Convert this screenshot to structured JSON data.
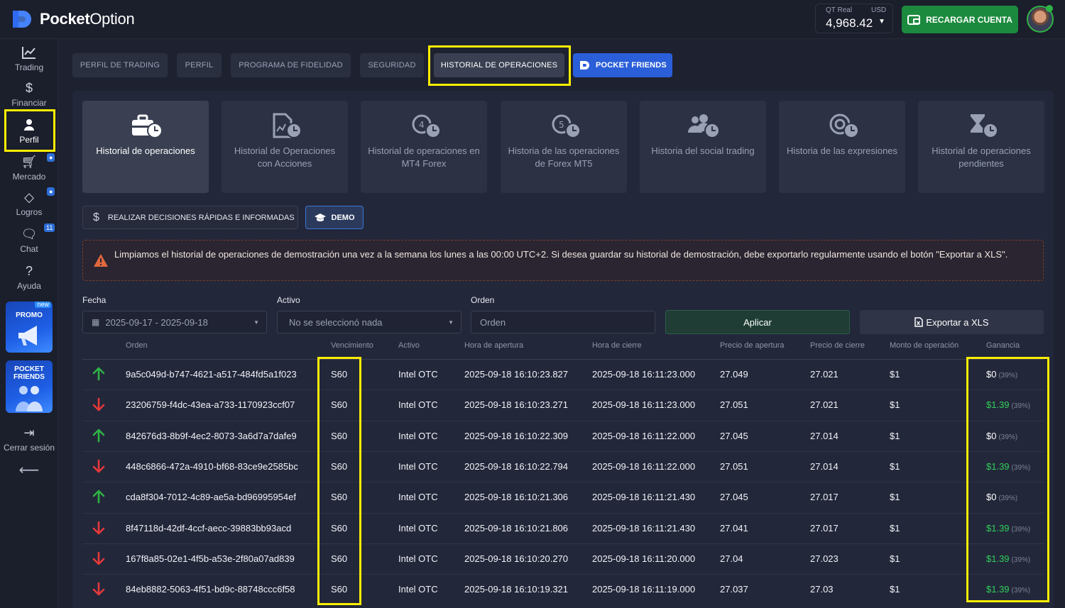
{
  "app": {
    "brand_bold": "Pocket",
    "brand_thin": "Option"
  },
  "account": {
    "type_label": "QT Real",
    "currency_label": "USD",
    "balance": "4,968.42",
    "recharge_label": "RECARGAR CUENTA"
  },
  "sidebar": {
    "items": [
      {
        "label": "Trading",
        "icon": "chart-line-icon"
      },
      {
        "label": "Financiar",
        "icon": "dollar-icon"
      },
      {
        "label": "Perfil",
        "icon": "user-icon"
      },
      {
        "label": "Mercado",
        "icon": "cart-icon"
      },
      {
        "label": "Logros",
        "icon": "diamond-icon"
      },
      {
        "label": "Chat",
        "icon": "chat-icon",
        "badge": "11"
      },
      {
        "label": "Ayuda",
        "icon": "help-icon"
      }
    ],
    "promo_label": "PROMO",
    "promo_new": "new",
    "friends_label_1": "POCKET",
    "friends_label_2": "FRIENDS",
    "logout_label": "Cerrar sesión"
  },
  "tabs": [
    {
      "label": "PERFIL DE TRADING"
    },
    {
      "label": "PERFIL"
    },
    {
      "label": "PROGRAMA DE FIDELIDAD"
    },
    {
      "label": "SEGURIDAD"
    },
    {
      "label": "HISTORIAL DE OPERACIONES",
      "active": true
    },
    {
      "label": "POCKET FRIENDS"
    }
  ],
  "categories": [
    {
      "label": "Historial de operaciones",
      "icon": "briefcase-clock-icon",
      "active": true
    },
    {
      "label": "Historial de Operaciones con Acciones",
      "icon": "document-chart-clock-icon"
    },
    {
      "label": "Historial de operaciones en MT4 Forex",
      "icon": "mt4-clock-icon"
    },
    {
      "label": "Historia de las operaciones de Forex MT5",
      "icon": "mt5-clock-icon"
    },
    {
      "label": "Historia del social trading",
      "icon": "users-clock-icon"
    },
    {
      "label": "Historia de las expresiones",
      "icon": "target-clock-icon"
    },
    {
      "label": "Historial de operaciones pendientes",
      "icon": "hourglass-clock-icon"
    }
  ],
  "actions": {
    "quick_label": "REALIZAR DECISIONES RÁPIDAS E INFORMADAS",
    "demo_label": "DEMO"
  },
  "alert": {
    "message": "Limpiamos el historial de operaciones de demostración una vez a la semana los lunes a las 00:00 UTC+2. Si desea guardar su historial de demostración, debe exportarlo regularmente usando el botón \"Exportar a XLS\"."
  },
  "filters": {
    "date_label": "Fecha",
    "date_value": "2025-09-17 - 2025-09-18",
    "asset_label": "Activo",
    "asset_value": "No se seleccionó nada",
    "order_label": "Orden",
    "order_placeholder": "Orden",
    "apply_label": "Aplicar",
    "export_label": "Exportar a XLS"
  },
  "table": {
    "headers": [
      "Orden",
      "Vencimiento",
      "Activo",
      "Hora de apertura",
      "Hora de cierre",
      "Precio de apertura",
      "Precio de cierre",
      "Monto de operación",
      "Ganancia"
    ],
    "rows": [
      {
        "dir": "up",
        "id": "9a5c049d-b747-4621-a517-484fd5a1f023",
        "exp": "S60",
        "asset": "Intel OTC",
        "open": "2025-09-18 16:10:23.827",
        "close": "2025-09-18 16:11:23.000",
        "open_price": "27.049",
        "close_price": "27.021",
        "amount": "$1",
        "gain": "$0",
        "pct": "(39%)"
      },
      {
        "dir": "down",
        "id": "23206759-f4dc-43ea-a733-1170923ccf07",
        "exp": "S60",
        "asset": "Intel OTC",
        "open": "2025-09-18 16:10:23.271",
        "close": "2025-09-18 16:11:23.000",
        "open_price": "27.051",
        "close_price": "27.021",
        "amount": "$1",
        "gain": "$1.39",
        "pct": "(39%)"
      },
      {
        "dir": "up",
        "id": "842676d3-8b9f-4ec2-8073-3a6d7a7dafe9",
        "exp": "S60",
        "asset": "Intel OTC",
        "open": "2025-09-18 16:10:22.309",
        "close": "2025-09-18 16:11:22.000",
        "open_price": "27.045",
        "close_price": "27.014",
        "amount": "$1",
        "gain": "$0",
        "pct": "(39%)"
      },
      {
        "dir": "down",
        "id": "448c6866-472a-4910-bf68-83ce9e2585bc",
        "exp": "S60",
        "asset": "Intel OTC",
        "open": "2025-09-18 16:10:22.794",
        "close": "2025-09-18 16:11:22.000",
        "open_price": "27.051",
        "close_price": "27.014",
        "amount": "$1",
        "gain": "$1.39",
        "pct": "(39%)"
      },
      {
        "dir": "up",
        "id": "cda8f304-7012-4c89-ae5a-bd96995954ef",
        "exp": "S60",
        "asset": "Intel OTC",
        "open": "2025-09-18 16:10:21.306",
        "close": "2025-09-18 16:11:21.430",
        "open_price": "27.045",
        "close_price": "27.017",
        "amount": "$1",
        "gain": "$0",
        "pct": "(39%)"
      },
      {
        "dir": "down",
        "id": "8f47118d-42df-4ccf-aecc-39883bb93acd",
        "exp": "S60",
        "asset": "Intel OTC",
        "open": "2025-09-18 16:10:21.806",
        "close": "2025-09-18 16:11:21.430",
        "open_price": "27.041",
        "close_price": "27.017",
        "amount": "$1",
        "gain": "$1.39",
        "pct": "(39%)"
      },
      {
        "dir": "down",
        "id": "167f8a85-02e1-4f5b-a53e-2f80a07ad839",
        "exp": "S60",
        "asset": "Intel OTC",
        "open": "2025-09-18 16:10:20.270",
        "close": "2025-09-18 16:11:20.000",
        "open_price": "27.04",
        "close_price": "27.023",
        "amount": "$1",
        "gain": "$1.39",
        "pct": "(39%)"
      },
      {
        "dir": "down",
        "id": "84eb8882-5063-4f51-bd9c-88748ccc6f58",
        "exp": "S60",
        "asset": "Intel OTC",
        "open": "2025-09-18 16:10:19.321",
        "close": "2025-09-18 16:11:19.000",
        "open_price": "27.037",
        "close_price": "27.03",
        "amount": "$1",
        "gain": "$1.39",
        "pct": "(39%)"
      }
    ]
  },
  "colors": {
    "accent_green": "#1c8a3e",
    "gain_green": "#2fd15a",
    "arrow_up": "#2fb344",
    "arrow_down": "#e5393a",
    "highlight": "#ffee00",
    "friends_blue": "#2b5fd9"
  }
}
